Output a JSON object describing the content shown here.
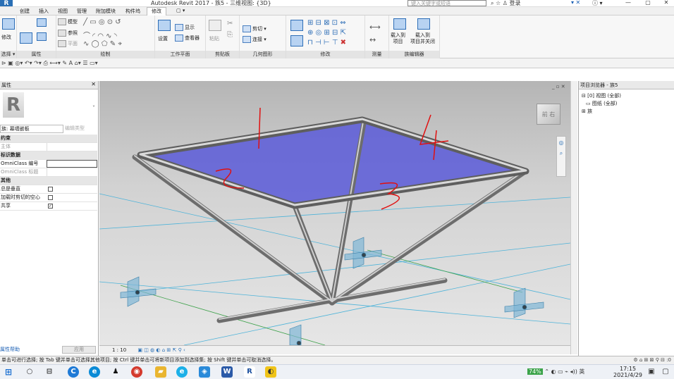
{
  "title_bar": {
    "app_title": "Autodesk Revit 2017 -    族5 - 三维视图: {3D}",
    "search_placeholder": "键入关键字或短语",
    "login": "登录",
    "help": "?"
  },
  "tabs": [
    {
      "label": "创建"
    },
    {
      "label": "插入"
    },
    {
      "label": "视图"
    },
    {
      "label": "管理"
    },
    {
      "label": "附加模块"
    },
    {
      "label": "构件坞"
    },
    {
      "label": "修改"
    },
    {
      "label": "▢ ▾"
    }
  ],
  "ribbon": {
    "select_label": "选择 ▾",
    "modify_button": "修改",
    "properties_label": "属性",
    "draw_label": "绘制",
    "draw_items": [
      "模型",
      "参照",
      "平面"
    ],
    "workplane_label": "工作平面",
    "workplane_items": [
      "设置",
      "显示",
      "查看器"
    ],
    "clipboard_label": "剪贴板",
    "clipboard_items": [
      "粘贴"
    ],
    "geometry_label": "几何图形",
    "geometry_items": [
      "剪切 ▾",
      "连接 ▾"
    ],
    "modify_label": "修改",
    "measure_label": "测量",
    "family_editor_label": "族编辑器",
    "load_project": "载入到\n项目",
    "load_project_close": "载入到\n项目并关闭"
  },
  "properties": {
    "header": "属性",
    "type_selector": "族: 幕墙嵌板",
    "edit_type": "编辑类型",
    "rows": [
      {
        "label": "约束",
        "section": true
      },
      {
        "label": "主体",
        "section": false,
        "greyed": true
      },
      {
        "label": "标识数据",
        "section": true
      },
      {
        "label": "OmniClass 编号",
        "section": false,
        "input": true
      },
      {
        "label": "OmniClass 标题",
        "section": false,
        "greyed": true
      },
      {
        "label": "其他",
        "section": true
      },
      {
        "label": "总是垂直",
        "section": false,
        "check": ""
      },
      {
        "label": "加载时剪切的空心",
        "section": false,
        "check": ""
      },
      {
        "label": "共享",
        "section": false,
        "check": "✓"
      }
    ],
    "help_link": "属性帮助",
    "apply_button": "应用"
  },
  "viewport": {
    "annotations": [
      "1",
      "2",
      "3",
      "4"
    ],
    "view_cube_label": "前 右"
  },
  "view_control": {
    "scale": "1 : 10"
  },
  "project_browser": {
    "header": "项目浏览器 - 族5",
    "items": [
      {
        "label": "[0] 视图 (全部)"
      },
      {
        "label": "图纸 (全部)"
      },
      {
        "label": "族"
      }
    ]
  },
  "status_bar": {
    "message": "单击可进行选择; 按 Tab 键并单击可选择其他项目; 按 Ctrl 键并单击可将新项目添加到选择集; 按 Shift 键并单击可取消选择。",
    "right": ":0"
  },
  "taskbar": {
    "battery": "74%",
    "ime": "英",
    "time": "17:15",
    "date": "2021/4/29"
  }
}
